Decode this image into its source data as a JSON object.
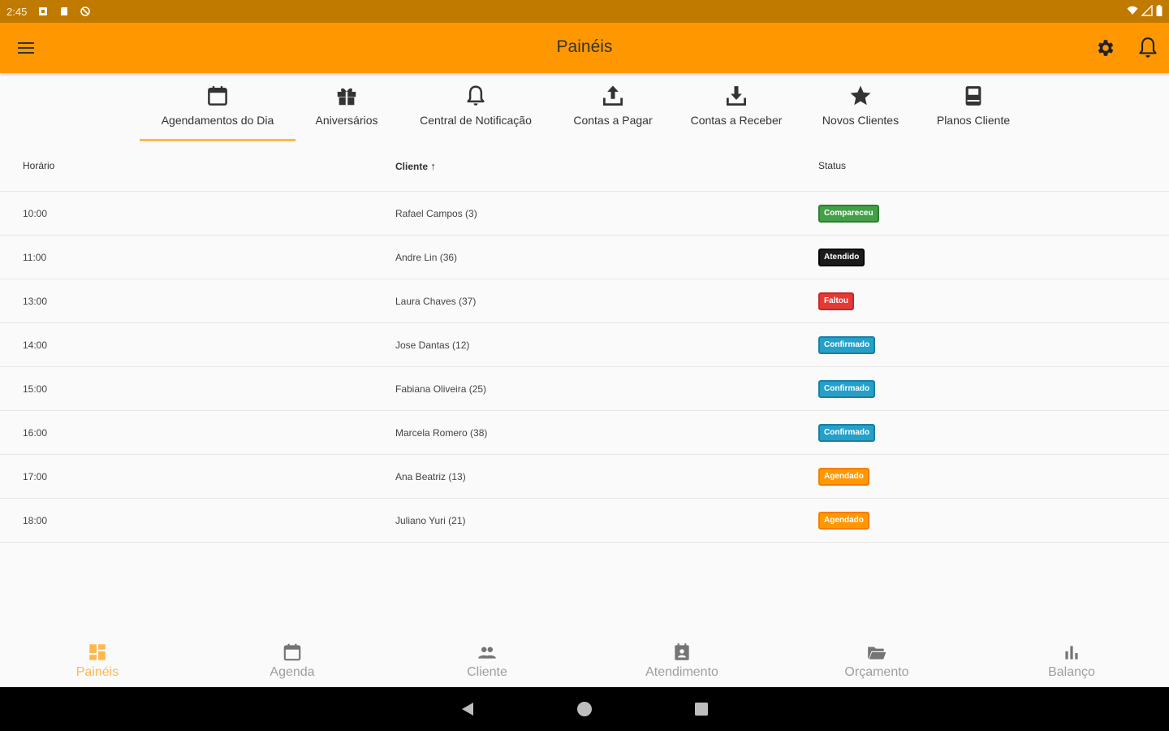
{
  "status_bar": {
    "time": "2:45"
  },
  "app_bar": {
    "title": "Painéis"
  },
  "tabs": [
    {
      "label": "Agendamentos do Dia",
      "icon": "calendar-icon",
      "active": true
    },
    {
      "label": "Aniversários",
      "icon": "gift-icon",
      "active": false
    },
    {
      "label": "Central de Notificação",
      "icon": "bell-icon",
      "active": false
    },
    {
      "label": "Contas a Pagar",
      "icon": "upload-icon",
      "active": false
    },
    {
      "label": "Contas a Receber",
      "icon": "download-icon",
      "active": false
    },
    {
      "label": "Novos Clientes",
      "icon": "star-icon",
      "active": false
    },
    {
      "label": "Planos Cliente",
      "icon": "book-icon",
      "active": false
    }
  ],
  "table": {
    "headers": {
      "time": "Horário",
      "client": "Cliente",
      "client_sort": "↑",
      "status": "Status"
    },
    "rows": [
      {
        "time": "10:00",
        "client": "Rafael Campos (3)",
        "status": "Compareceu"
      },
      {
        "time": "11:00",
        "client": "Andre Lin (36)",
        "status": "Atendido"
      },
      {
        "time": "13:00",
        "client": "Laura Chaves (37)",
        "status": "Faltou"
      },
      {
        "time": "14:00",
        "client": "Jose Dantas (12)",
        "status": "Confirmado"
      },
      {
        "time": "15:00",
        "client": "Fabiana Oliveira (25)",
        "status": "Confirmado"
      },
      {
        "time": "16:00",
        "client": "Marcela Romero (38)",
        "status": "Confirmado"
      },
      {
        "time": "17:00",
        "client": "Ana Beatriz (13)",
        "status": "Agendado"
      },
      {
        "time": "18:00",
        "client": "Juliano Yuri (21)",
        "status": "Agendado"
      }
    ]
  },
  "status_colors": {
    "Compareceu": {
      "bg": "#43a047",
      "border": "#2e7d32"
    },
    "Atendido": {
      "bg": "#1b1b1b",
      "border": "#000000"
    },
    "Faltou": {
      "bg": "#e53935",
      "border": "#c62828"
    },
    "Confirmado": {
      "bg": "#26a0c8",
      "border": "#1a7fa3"
    },
    "Agendado": {
      "bg": "#ff9800",
      "border": "#f57c00"
    }
  },
  "bottom_nav": [
    {
      "label": "Painéis",
      "icon": "dashboard-icon",
      "active": true
    },
    {
      "label": "Agenda",
      "icon": "calendar-icon",
      "active": false
    },
    {
      "label": "Cliente",
      "icon": "people-icon",
      "active": false
    },
    {
      "label": "Atendimento",
      "icon": "contact-icon",
      "active": false
    },
    {
      "label": "Orçamento",
      "icon": "folder-open-icon",
      "active": false
    },
    {
      "label": "Balanço",
      "icon": "bar-chart-icon",
      "active": false
    }
  ],
  "colors": {
    "accent": "#ff9800",
    "status_bar": "#c17a00",
    "active_tab": "#ffb74d"
  }
}
